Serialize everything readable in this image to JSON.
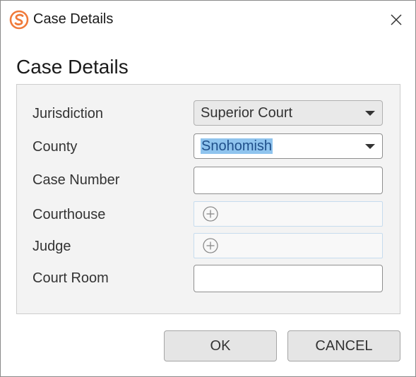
{
  "window": {
    "title": "Case Details"
  },
  "heading": "Case Details",
  "fields": {
    "jurisdiction": {
      "label": "Jurisdiction",
      "value": "Superior Court"
    },
    "county": {
      "label": "County",
      "value": "Snohomish"
    },
    "case_number": {
      "label": "Case Number",
      "value": ""
    },
    "courthouse": {
      "label": "Courthouse",
      "icon": "add-circle-icon"
    },
    "judge": {
      "label": "Judge",
      "icon": "add-circle-icon"
    },
    "court_room": {
      "label": "Court Room",
      "value": ""
    }
  },
  "buttons": {
    "ok": "OK",
    "cancel": "CANCEL"
  },
  "colors": {
    "brand": "#f07a3a",
    "selection": "#8fc4ee",
    "lookup_border": "#c6dcee"
  }
}
